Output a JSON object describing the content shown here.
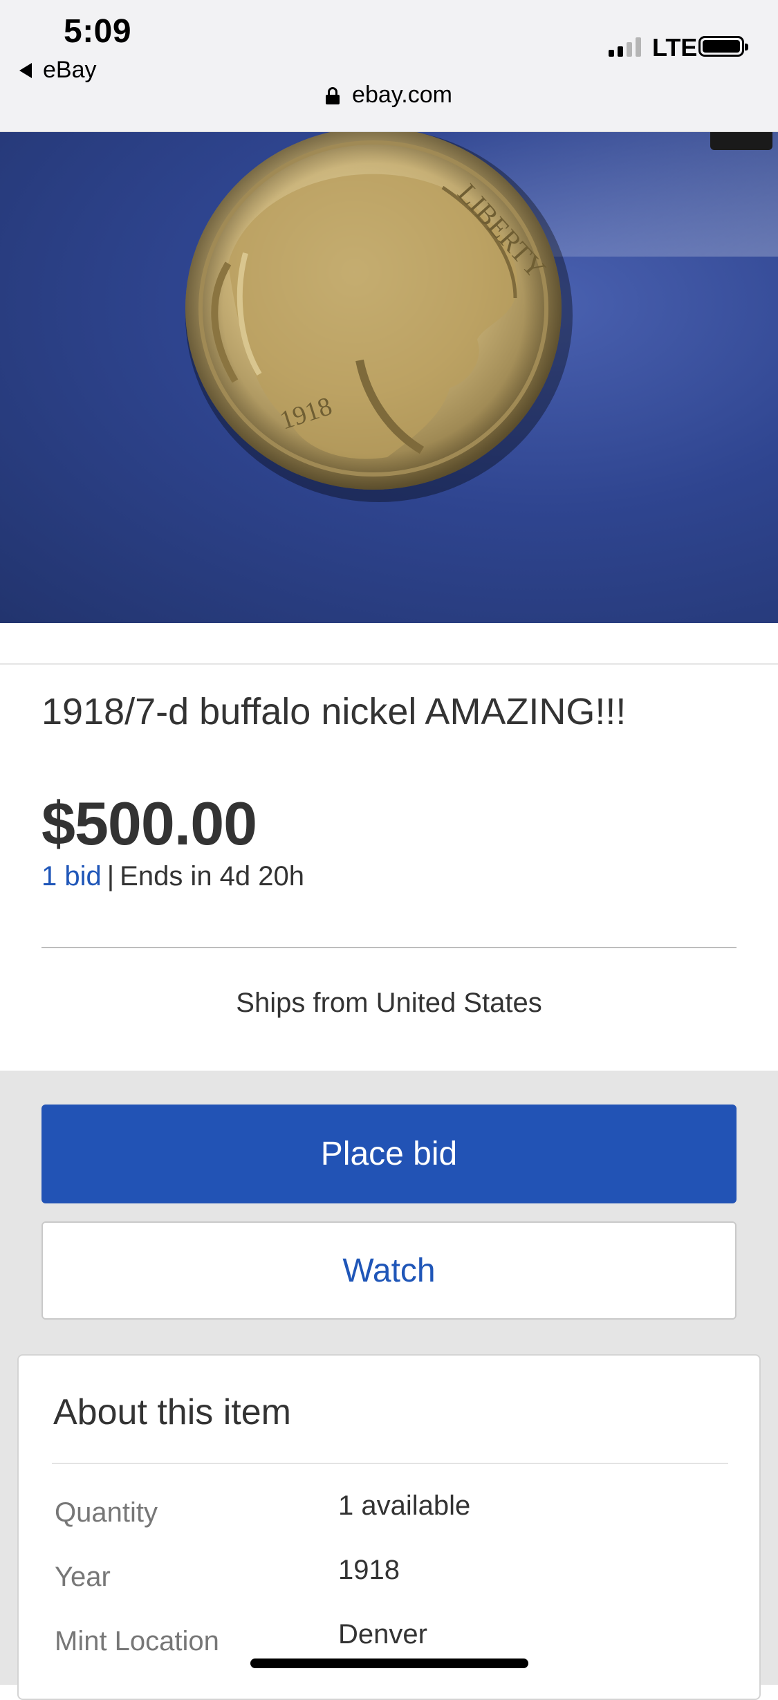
{
  "status": {
    "time": "5:09",
    "back_app": "eBay",
    "network": "LTE",
    "url": "ebay.com"
  },
  "listing": {
    "image_alt": "1918 buffalo nickel coin on blue background",
    "coin_lettering": "LIBERTY",
    "coin_date": "1918",
    "title": "1918/7-d buffalo nickel AMAZING!!!",
    "price": "$500.00",
    "bids": "1 bid",
    "separator": "|",
    "ends": "Ends in 4d 20h",
    "ships_from": "Ships from United States"
  },
  "actions": {
    "place_bid": "Place bid",
    "watch": "Watch"
  },
  "about": {
    "title": "About this item",
    "specs": [
      {
        "label": "Quantity",
        "value": "1 available"
      },
      {
        "label": "Year",
        "value": "1918"
      },
      {
        "label": "Mint Location",
        "value": "Denver"
      }
    ]
  },
  "colors": {
    "accent_blue": "#2253b5",
    "link_blue": "#1f56b8",
    "background_gray": "#e5e5e5"
  },
  "icons": [
    "back-arrow-icon",
    "signal-icon",
    "battery-icon",
    "lock-icon"
  ]
}
